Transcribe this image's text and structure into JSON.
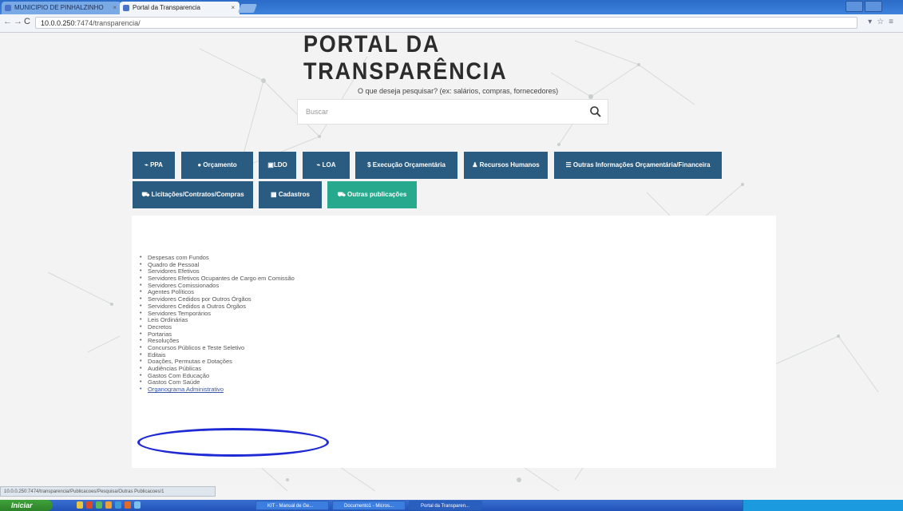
{
  "browser": {
    "tabs": [
      {
        "label": "MUNICIPIO DE PINHALZINHO"
      },
      {
        "label": "Portal da Transparencia"
      }
    ],
    "url_host": "10.0.0.250",
    "url_path": ":7474/transparencia/"
  },
  "page": {
    "title": "PORTAL DA TRANSPARÊNCIA",
    "search_prompt": "O que deseja pesquisar? (ex: salários, compras, fornecedores)",
    "search_placeholder": "Buscar",
    "nav_row1": [
      {
        "label": "PPA",
        "icon": "chart-icon"
      },
      {
        "label": "Orçamento",
        "icon": "pie-icon"
      },
      {
        "label": "LDO",
        "icon": "calendar-icon"
      },
      {
        "label": "LOA",
        "icon": "chart-icon"
      },
      {
        "label": "Execução Orçamentária",
        "icon": "dollar-icon"
      },
      {
        "label": "Recursos Humanos",
        "icon": "users-icon"
      },
      {
        "label": "Outras Informações Orçamentária/Financeira",
        "icon": "list-icon"
      }
    ],
    "nav_row2": [
      {
        "label": "Licitações/Contratos/Compras",
        "icon": "cart-icon"
      },
      {
        "label": "Cadastros",
        "icon": "table-icon"
      },
      {
        "label": "Outras publicações",
        "icon": "cart-icon",
        "active": true
      }
    ],
    "publications": [
      "Despesas com Fundos",
      "Quadro de Pessoal",
      "Servidores Efetivos",
      "Servidores Efetivos Ocupantes de Cargo em Comissão",
      "Servidores Comissionados",
      "Agentes Políticos",
      "Servidores Cedidos por Outros Órgãos",
      "Servidores Cedidos a Outros Órgãos",
      "Servidores Temporários",
      "Leis Ordinárias",
      "Decretos",
      "Portarias",
      "Resoluções",
      "Concursos Públicos e Teste Seletivo",
      "Editais",
      "Doações, Permutas e Dotações",
      "Audiências Públicas",
      "Gastos Com Educação",
      "Gastos Com Saúde",
      "Organograma Administrativo"
    ]
  },
  "statusbar": {
    "text": "10.0.0.250:7474/transparencia/Publicacoes/Pesquisa/Outras Publicacoes/1"
  },
  "taskbar": {
    "start_label": "Iniciar",
    "items": [
      "KIT - Manual de Ge...",
      "Documento1 - Micros...",
      "Portal da Transparen..."
    ]
  },
  "colors": {
    "nav_blue": "#2a5b80",
    "nav_green": "#26a98c",
    "highlight_oval": "#1f2ad4"
  }
}
